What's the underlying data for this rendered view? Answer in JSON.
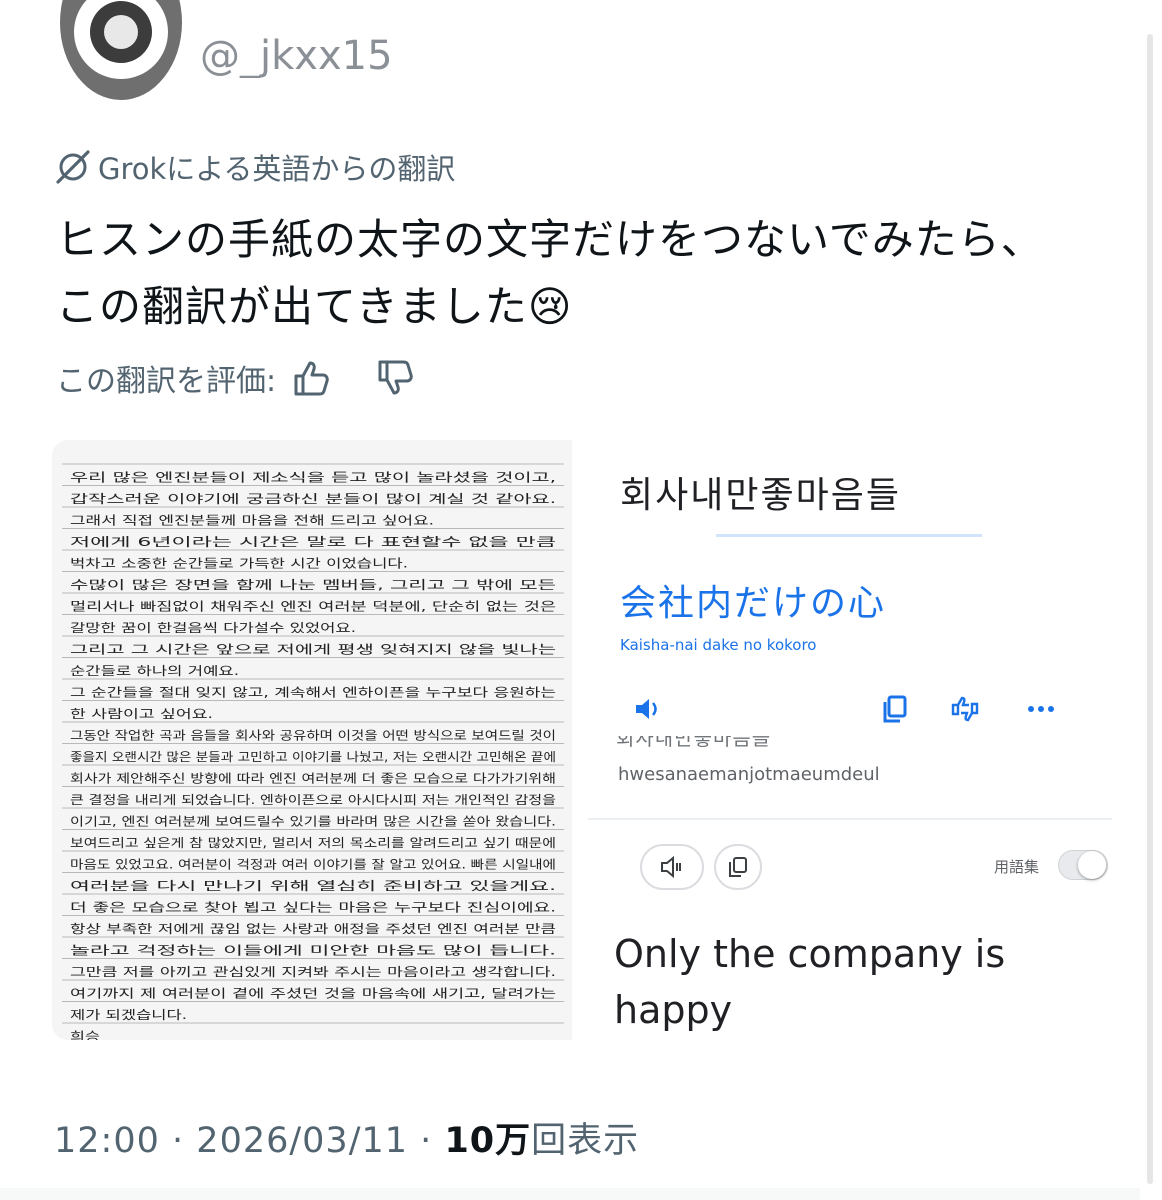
{
  "user": {
    "handle": "@_jkxx15"
  },
  "translation_banner": {
    "icon": "grok-icon",
    "text": "Grokによる英語からの翻訳"
  },
  "tweet": {
    "lines": [
      "ヒスンの手紙の太字の文字だけをつないでみたら、",
      "この翻訳が出てきました😢"
    ]
  },
  "rating": {
    "label": "この翻訳を評価:",
    "up_icon": "thumbs-up-icon",
    "down_icon": "thumbs-down-icon"
  },
  "media": {
    "letter_lines": [
      "우리 많은 엔진분들이 제소식을 듣고 많이 놀라셨을 것이고,",
      "갑작스러운 이야기에 궁금하신 분들이 많이 계실 것 같아요.",
      "그래서 직접 엔진분들께 마음을 전해 드리고 싶어요.",
      "저에게 6년이라는 시간은 말로 다 표현할수 없을 만큼",
      "벅차고 소중한 순간들로 가득한 시간 이었습니다.",
      "수많이 많은 장면을 함께 나눈 멤버들, 그리고 그 밖에 모든",
      "멀리서나 빠짐없이 채워주신 엔진 여러분 덕분에, 단순히 없는 것은",
      "갈망한 꿈이 한걸음씩 다가설수 있었어요.",
      "그리고 그 시간은 앞으로 저에게 평생 잊혀지지 않을 빛나는",
      "순간들로 하나의 거예요.",
      "그 순간들을 절대 잊지 않고, 계속해서 엔하이픈을 누구보다 응원하는",
      "한 사람이고 싶어요.",
      "그동안 작업한 곡과 음들을 회사와 공유하며 이것을 어떤 방식으로 보여드릴 것이",
      "좋을지 오랜시간 많은 분들과 고민하고 이야기를 나눴고, 저는 오랜시간 고민해온 끝에",
      "회사가 제안해주신 방향에 따라 엔진 여러분께 더 좋은 모습으로 다가가기위해",
      "큰 결정을 내리게 되었습니다. 엔하이픈으로 아시다시피 저는 개인적인 감정을",
      "이기고, 엔진 여러분께 보여드릴수 있기를 바라며 많은 시간을 쏟아 왔습니다.",
      "보여드리고 싶은게 참 많았지만, 멀리서 저의 목소리를 알려드리고 싶기 때문에",
      "마음도 있었고요. 여러분이 걱정과 여러 이야기를 잘 알고 있어요. 빠른 시일내에",
      "여러분을 다시 만나기 위해 열심히 준비하고 있을게요.",
      "더 좋은 모습으로 찾아 뵙고 싶다는 마음은 누구보다 진심이에요.",
      "항상 부족한 저에게 끊임 없는 사랑과 애정을 주셨던 엔진 여러분 만큼",
      "놀라고 걱정하는 이들에게 미안한 마음도 많이 듭니다.",
      "그만큼 저를 아끼고 관심있게 지켜봐 주시는 마음이라고 생각합니다.",
      "여기까지 제 여러분이 곁에 주셨던 것을 마음속에 새기고, 달려가는",
      "제가 되겠습니다.",
      "희승"
    ],
    "translator": {
      "source_text": "회사내만좋마음들",
      "target_text": "会社内だけの心",
      "romanization": "Kaisha-nai dake no kokoro",
      "actions": [
        "speaker-icon",
        "copy-icon",
        "swap-feedback-icon",
        "more-icon"
      ],
      "cut_text": "회사내만좋마음들",
      "source_romanization": "hwesanaemanjotmaeumdeul",
      "mode_buttons": [
        "speaker-slow-icon",
        "copy-icon"
      ],
      "glossary_label": "用語集",
      "glossary_on": false,
      "output_text": "Only the company is happy"
    }
  },
  "meta": {
    "time": "12:00",
    "separator": "·",
    "date": "2026/03/11",
    "views_count": "10万",
    "views_label": "回表示"
  },
  "colors": {
    "text": "#0f1419",
    "secondary": "#536471",
    "google_blue": "#1a73e8"
  }
}
